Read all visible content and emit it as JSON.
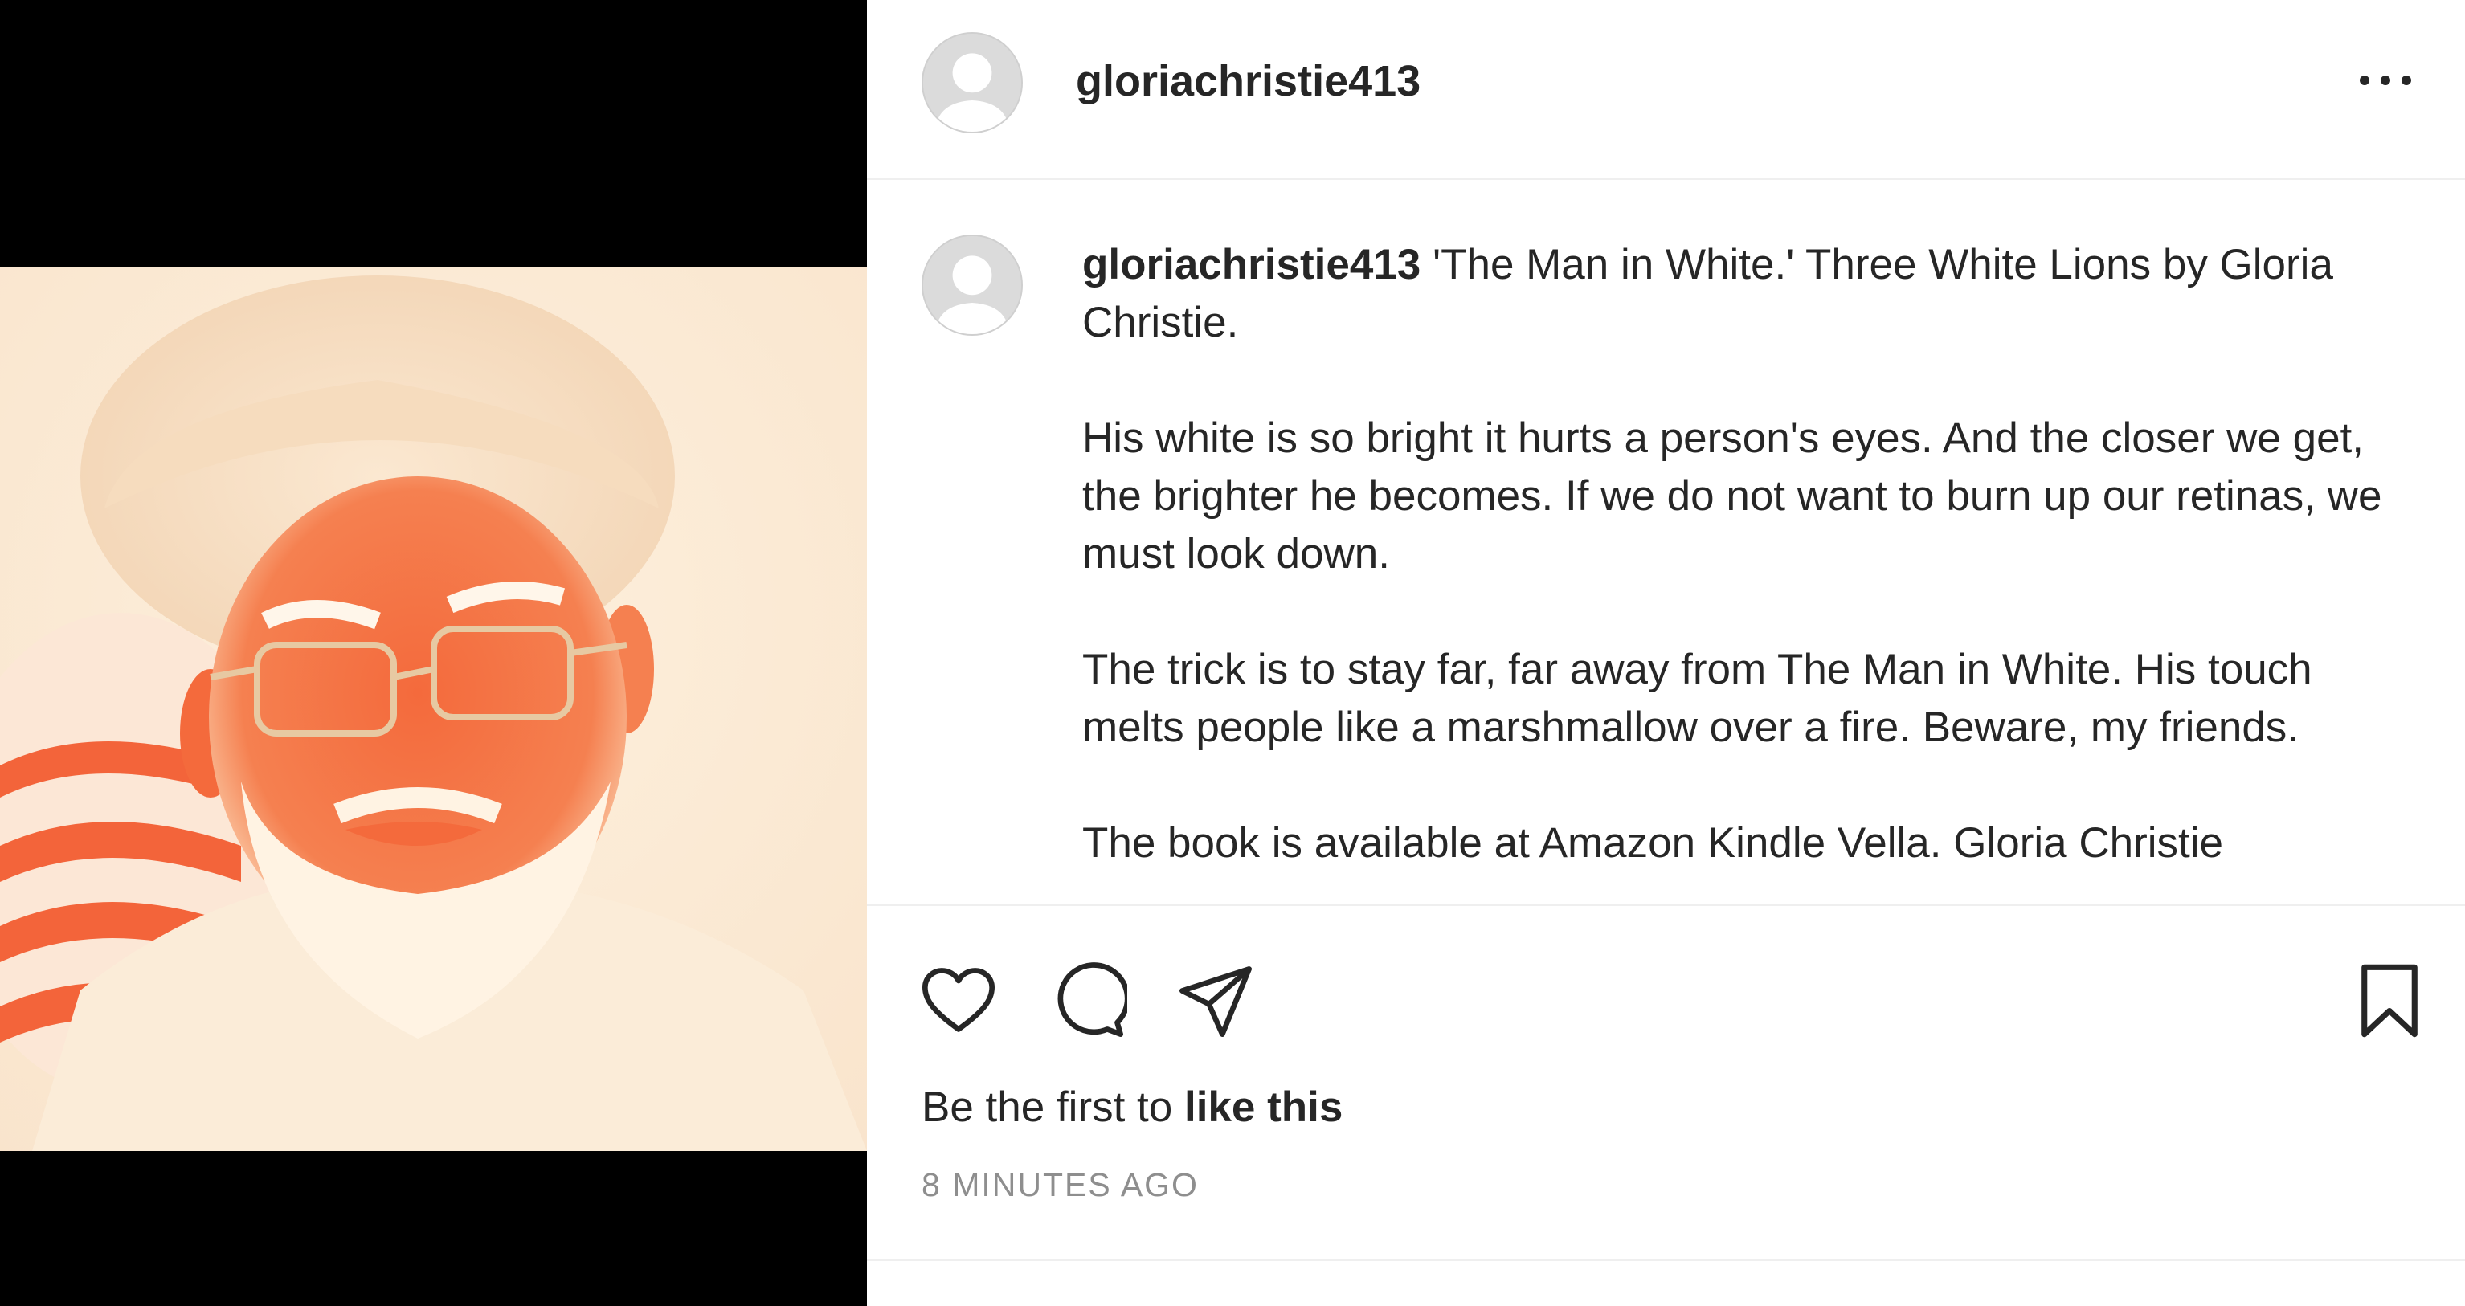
{
  "post": {
    "username": "gloriachristie413",
    "image_alt": "Inverted-color portrait of an elderly man in a white turban with glasses and a white beard",
    "caption": {
      "username": "gloriachristie413",
      "text_line1": " 'The Man in White.' Three White Lions by Gloria Christie.",
      "para2": "His white is so bright it hurts a person's eyes. And the closer we get, the brighter he becomes. If we do not want to burn up our retinas, we must look down.",
      "para3": "The trick is to stay far, far away from The Man in White. His touch melts people like a marshmallow over a fire. Beware, my friends.",
      "para4": "The book is available at Amazon Kindle Vella. Gloria Christie"
    },
    "likes": {
      "prefix": "Be the first to ",
      "action": "like this"
    },
    "timestamp": "8 MINUTES AGO"
  },
  "icons": {
    "more": "more-options-icon",
    "like": "heart-icon",
    "comment": "comment-icon",
    "share": "share-icon",
    "save": "bookmark-icon"
  },
  "colors": {
    "text": "#262626",
    "muted": "#8e8e8e",
    "divider": "#efefef",
    "media_bg": "#000000"
  }
}
